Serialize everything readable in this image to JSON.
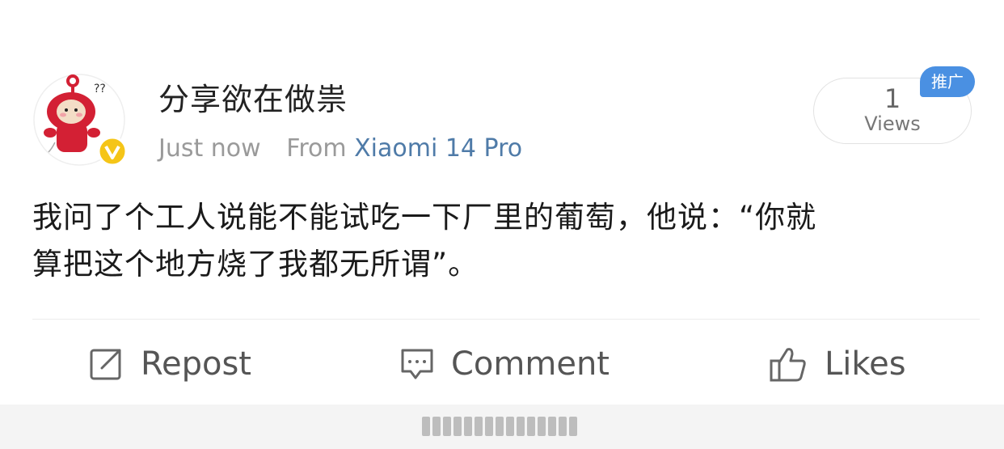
{
  "post": {
    "username": "分享欲在做祟",
    "timestamp": "Just now",
    "source_prefix": "From",
    "device": "Xiaomi 14 Pro",
    "views_count": "1",
    "views_label": "Views",
    "promo_badge": "推广",
    "text_line1": "我问了个工人说能不能试吃一下厂里的葡萄，他说：“你就",
    "text_line2": "算把这个地方烧了我都无所谓”。",
    "verified_badge_color": "#f5c518"
  },
  "actions": {
    "repost_label": "Repost",
    "comment_label": "Comment",
    "likes_label": "Likes"
  },
  "icons": [
    "avatar-image",
    "verified-icon",
    "repost-icon",
    "comment-icon",
    "like-icon"
  ]
}
